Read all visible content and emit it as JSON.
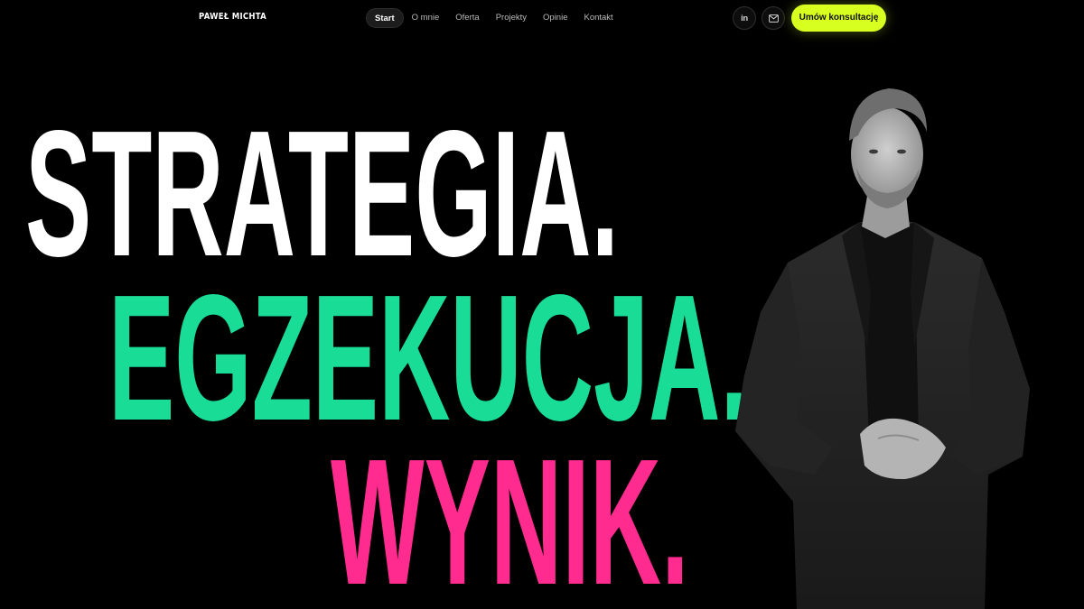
{
  "brand": "PAWEŁ MICHTA",
  "nav": {
    "items": [
      {
        "label": "Start",
        "active": true
      },
      {
        "label": "O mnie"
      },
      {
        "label": "Oferta"
      },
      {
        "label": "Projekty"
      },
      {
        "label": "Opinie"
      },
      {
        "label": "Kontakt"
      }
    ]
  },
  "social": {
    "linkedin_icon": "linkedin-icon",
    "linkedin_text": "in",
    "mail_icon": "mail-icon"
  },
  "cta": {
    "label": "Umów konsultację"
  },
  "hero": {
    "line1": "STRATEGIA.",
    "line2": "EGZEKUCJA.",
    "line3": "WYNIK."
  },
  "colors": {
    "background": "#000000",
    "line1": "#ffffff",
    "line2": "#19dd97",
    "line3": "#ff2b8f",
    "accent": "#d7ff1f"
  }
}
